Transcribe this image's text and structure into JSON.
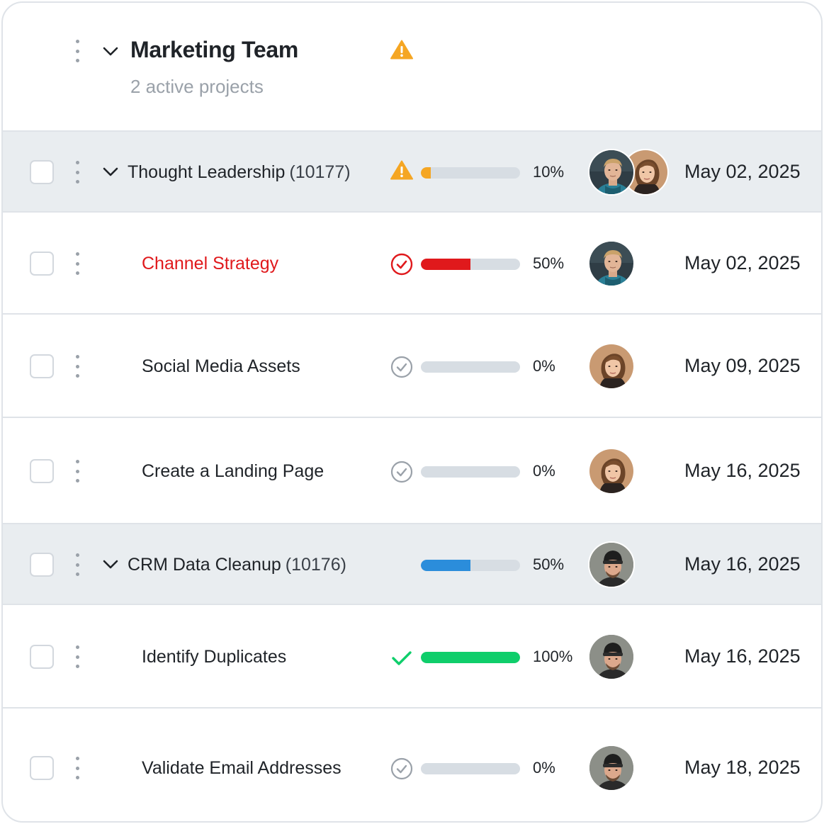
{
  "group": {
    "title": "Marketing Team",
    "subtitle": "2 active projects",
    "status_icon": "warning-icon",
    "warning_color": "#f5a623"
  },
  "colors": {
    "warning": "#f5a623",
    "danger": "#e0191c",
    "info": "#2b8ddb",
    "success": "#0fce6b",
    "muted": "#9aa1a9"
  },
  "rows": [
    {
      "type": "parent",
      "name": "Thought Leadership",
      "id": "(10177)",
      "status": "warning",
      "progress_label": "10%",
      "progress": 0.1,
      "bar_color": "#f5a623",
      "assignees": [
        "man-blond",
        "woman-brown"
      ],
      "date": "May 02, 2025"
    },
    {
      "type": "task",
      "name": "Channel Strategy",
      "status": "overdue",
      "progress_label": "50%",
      "progress": 0.5,
      "bar_color": "#e0191c",
      "assignees": [
        "man-blond"
      ],
      "date": "May 02, 2025"
    },
    {
      "type": "task",
      "name": "Social Media Assets",
      "status": "pending",
      "progress_label": "0%",
      "progress": 0,
      "bar_color": "#d7dde3",
      "assignees": [
        "woman-brown"
      ],
      "date": "May 09, 2025"
    },
    {
      "type": "task",
      "name": "Create a Landing Page",
      "status": "pending",
      "progress_label": "0%",
      "progress": 0,
      "bar_color": "#d7dde3",
      "assignees": [
        "woman-brown"
      ],
      "date": "May 16, 2025"
    },
    {
      "type": "parent",
      "name": "CRM Data Cleanup",
      "id": "(10176)",
      "status": "none",
      "progress_label": "50%",
      "progress": 0.5,
      "bar_color": "#2b8ddb",
      "assignees": [
        "man-beanie"
      ],
      "date": "May 16, 2025"
    },
    {
      "type": "task",
      "name": "Identify Duplicates",
      "status": "done",
      "progress_label": "100%",
      "progress": 1.0,
      "bar_color": "#0fce6b",
      "assignees": [
        "man-beanie"
      ],
      "date": "May 16, 2025"
    },
    {
      "type": "task",
      "name": "Validate Email Addresses",
      "status": "pending",
      "progress_label": "0%",
      "progress": 0,
      "bar_color": "#d7dde3",
      "assignees": [
        "man-beanie"
      ],
      "date": "May 18, 2025"
    }
  ]
}
